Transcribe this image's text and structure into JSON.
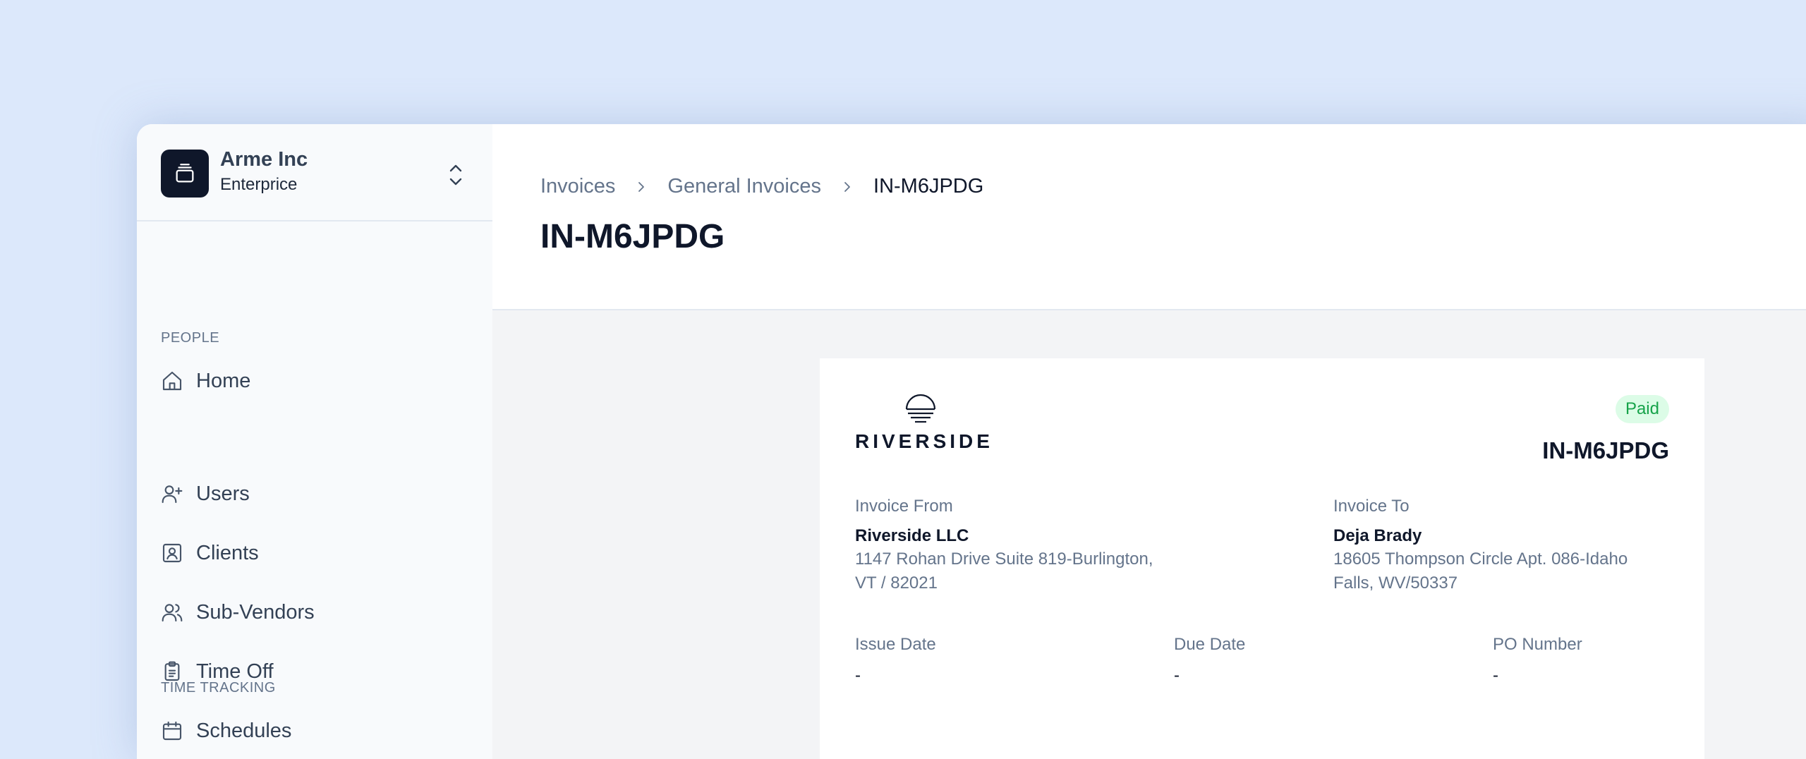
{
  "org": {
    "name": "Arme Inc",
    "plan": "Enterprice"
  },
  "nav": {
    "home": "Home",
    "sections": {
      "people": "PEOPLE",
      "time_tracking": "TIME TRACKING"
    },
    "people_items": [
      "Users",
      "Clients",
      "Sub-Vendors",
      "Time Off",
      "Schedules"
    ]
  },
  "breadcrumb": [
    "Invoices",
    "General Invoices",
    "IN-M6JPDG"
  ],
  "page_title": "IN-M6JPDG",
  "invoice": {
    "brand": "RIVERSIDE",
    "status": "Paid",
    "number": "IN-M6JPDG",
    "from": {
      "label": "Invoice From",
      "name": "Riverside LLC",
      "address_line1": "1147 Rohan Drive Suite 819-Burlington,",
      "address_line2": "VT / 82021"
    },
    "to": {
      "label": "Invoice To",
      "name": "Deja Brady",
      "address_line1": "18605 Thompson Circle Apt. 086-Idaho",
      "address_line2": "Falls, WV/50337"
    },
    "issue_date": {
      "label": "Issue Date",
      "value": "-"
    },
    "due_date": {
      "label": "Due Date",
      "value": "-"
    },
    "po_number": {
      "label": "PO Number",
      "value": "-"
    }
  },
  "colors": {
    "background": "#dce8fb",
    "status_paid_bg": "#dcfce7",
    "status_paid_text": "#16a34a"
  }
}
